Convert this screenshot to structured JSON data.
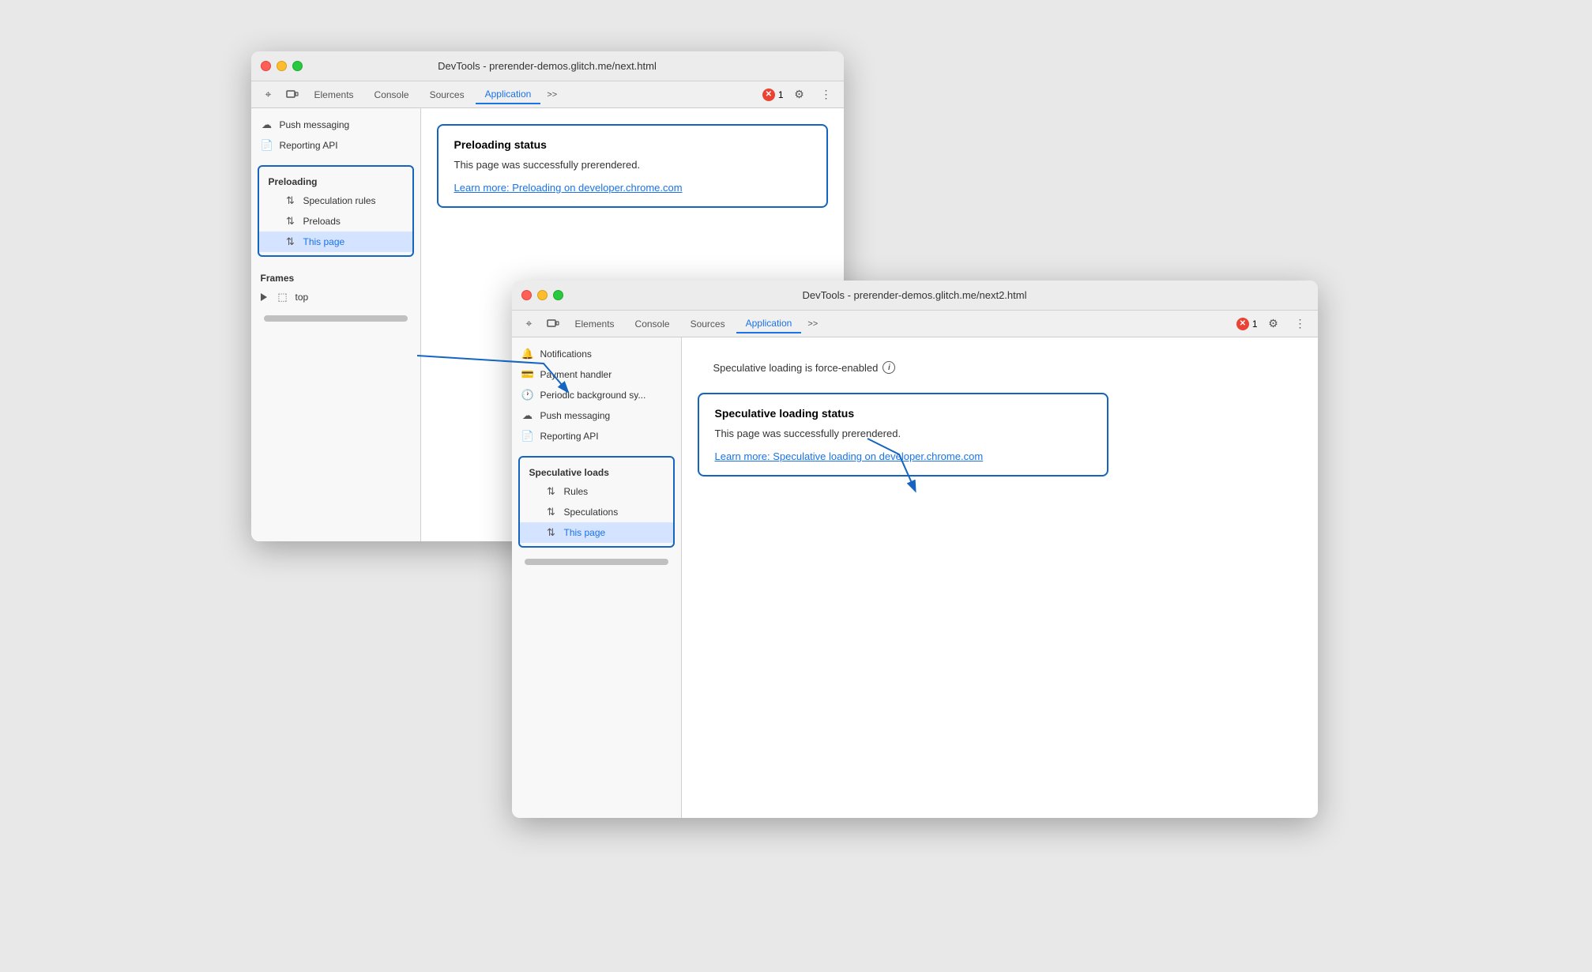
{
  "window1": {
    "title": "DevTools - prerender-demos.glitch.me/next.html",
    "tabs": [
      "Elements",
      "Console",
      "Sources",
      "Application",
      ">>"
    ],
    "active_tab": "Application",
    "error_count": "1",
    "sidebar": {
      "push_messaging": "Push messaging",
      "reporting_api": "Reporting API",
      "preloading_section": "Preloading",
      "speculation_rules": "Speculation rules",
      "preloads": "Preloads",
      "this_page": "This page",
      "frames_section": "Frames",
      "frames_top": "top"
    },
    "panel": {
      "status_title": "Preloading status",
      "status_text": "This page was successfully prerendered.",
      "learn_more_link": "Learn more: Preloading on developer.chrome.com"
    }
  },
  "window2": {
    "title": "DevTools - prerender-demos.glitch.me/next2.html",
    "tabs": [
      "Elements",
      "Console",
      "Sources",
      "Application",
      ">>"
    ],
    "active_tab": "Application",
    "error_count": "1",
    "sidebar": {
      "notifications": "Notifications",
      "payment_handler": "Payment handler",
      "periodic_background": "Periodic background sy...",
      "push_messaging": "Push messaging",
      "reporting_api": "Reporting API",
      "speculative_loads": "Speculative loads",
      "rules": "Rules",
      "speculations": "Speculations",
      "this_page": "This page"
    },
    "panel": {
      "force_enabled_text": "Speculative loading is force-enabled",
      "status_title": "Speculative loading status",
      "status_text": "This page was successfully prerendered.",
      "learn_more_link": "Learn more: Speculative loading on developer.chrome.com"
    }
  },
  "icons": {
    "cursor": "⌖",
    "device": "⬜",
    "sort": "⇅",
    "cloud": "☁",
    "doc": "📄",
    "frame": "⬚",
    "payment": "💳",
    "clock": "🕐",
    "gear": "⚙",
    "menu": "⋮",
    "chevron": "≫"
  }
}
